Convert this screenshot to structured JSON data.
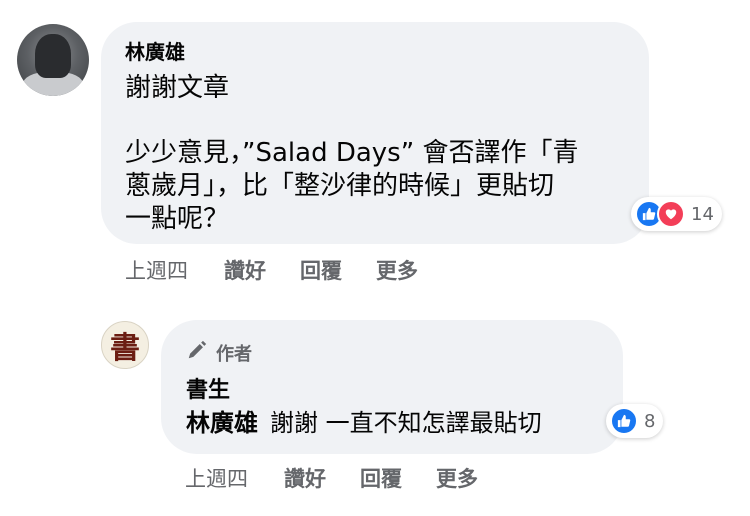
{
  "comment": {
    "author": "林廣雄",
    "text_lines": [
      "謝謝文章",
      "少少意見，”Salad Days” 會否譯作「青",
      "蔥歲月」，比「整沙律的時候」更貼切",
      "一點呢？"
    ],
    "reactions": {
      "icons": [
        "like-icon",
        "love-icon"
      ],
      "count": "14"
    },
    "actions": {
      "time": "上週四",
      "like": "讚好",
      "reply": "回覆",
      "more": "更多"
    }
  },
  "reply": {
    "badge": "作者",
    "author": "書生",
    "avatar_glyph": "書",
    "mention": "林廣雄",
    "text": "謝謝 一直不知怎譯最貼切",
    "reactions": {
      "icons": [
        "like-icon"
      ],
      "count": "8"
    },
    "actions": {
      "time": "上週四",
      "like": "讚好",
      "reply": "回覆",
      "more": "更多"
    }
  },
  "colors": {
    "bubble": "#f0f2f5",
    "like": "#1877f2",
    "love": "#f33e58",
    "meta": "#65676b"
  }
}
